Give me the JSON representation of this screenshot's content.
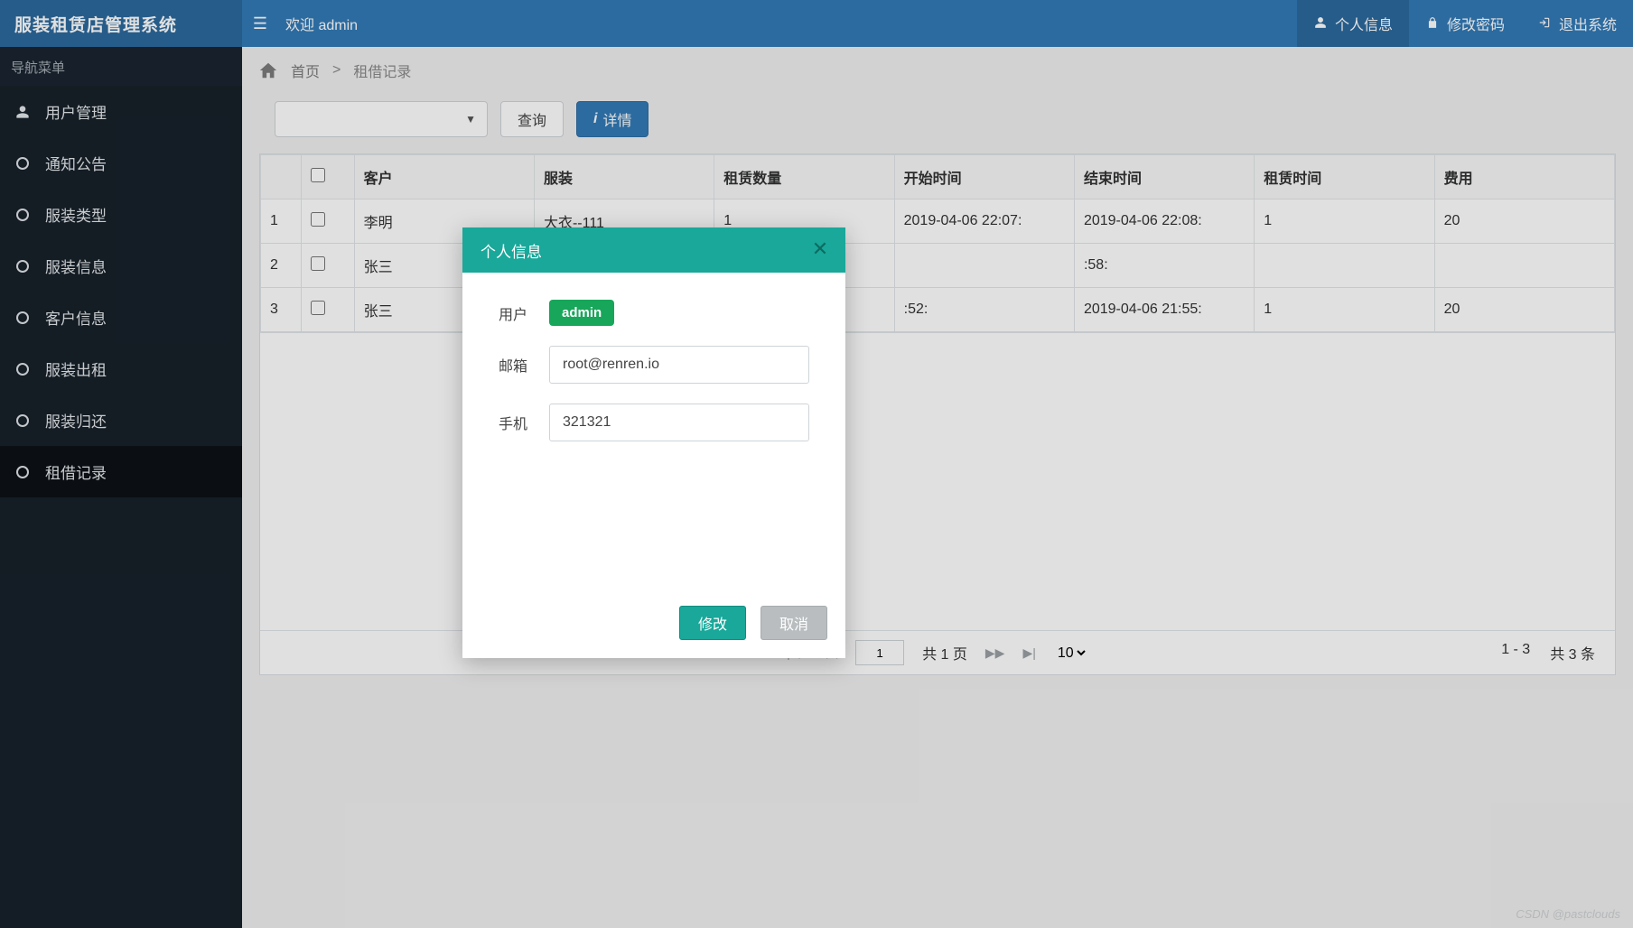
{
  "header": {
    "brand": "服装租赁店管理系统",
    "welcome": "欢迎 admin",
    "items": [
      {
        "label": "个人信息",
        "icon": "user-icon"
      },
      {
        "label": "修改密码",
        "icon": "lock-icon"
      },
      {
        "label": "退出系统",
        "icon": "logout-icon"
      }
    ]
  },
  "sidebar": {
    "header": "导航菜单",
    "items": [
      {
        "label": "用户管理",
        "icon": "user"
      },
      {
        "label": "通知公告",
        "icon": "circle"
      },
      {
        "label": "服装类型",
        "icon": "circle"
      },
      {
        "label": "服装信息",
        "icon": "circle"
      },
      {
        "label": "客户信息",
        "icon": "circle"
      },
      {
        "label": "服装出租",
        "icon": "circle"
      },
      {
        "label": "服装归还",
        "icon": "circle"
      },
      {
        "label": "租借记录",
        "icon": "circle"
      }
    ],
    "active_index": 7
  },
  "breadcrumb": {
    "home_label": "首页",
    "sep": ">",
    "current": "租借记录"
  },
  "toolbar": {
    "search_label": "查询",
    "detail_label": "详情"
  },
  "table": {
    "columns": [
      "客户",
      "服装",
      "租赁数量",
      "开始时间",
      "结束时间",
      "租赁时间",
      "费用"
    ],
    "rows": [
      {
        "idx": "1",
        "cells": [
          "李明",
          "大衣--111",
          "1",
          "2019-04-06 22:07:",
          "2019-04-06 22:08:",
          "1",
          "20"
        ]
      },
      {
        "idx": "2",
        "cells": [
          "张三",
          "",
          "",
          "",
          ":58:",
          "",
          ""
        ]
      },
      {
        "idx": "3",
        "cells": [
          "张三",
          "",
          "",
          ":52:",
          "2019-04-06 21:55:",
          "1",
          "20"
        ]
      }
    ]
  },
  "pager": {
    "page_input": "1",
    "total_pages_label": "共 1 页",
    "page_size": "10",
    "range": "1 - 3",
    "total_label": "共 3 条"
  },
  "modal": {
    "title": "个人信息",
    "user_label": "用户",
    "user_value": "admin",
    "email_label": "邮箱",
    "email_value": "root@renren.io",
    "phone_label": "手机",
    "phone_value": "321321",
    "submit_label": "修改",
    "cancel_label": "取消"
  },
  "watermark": "CSDN @pastclouds"
}
